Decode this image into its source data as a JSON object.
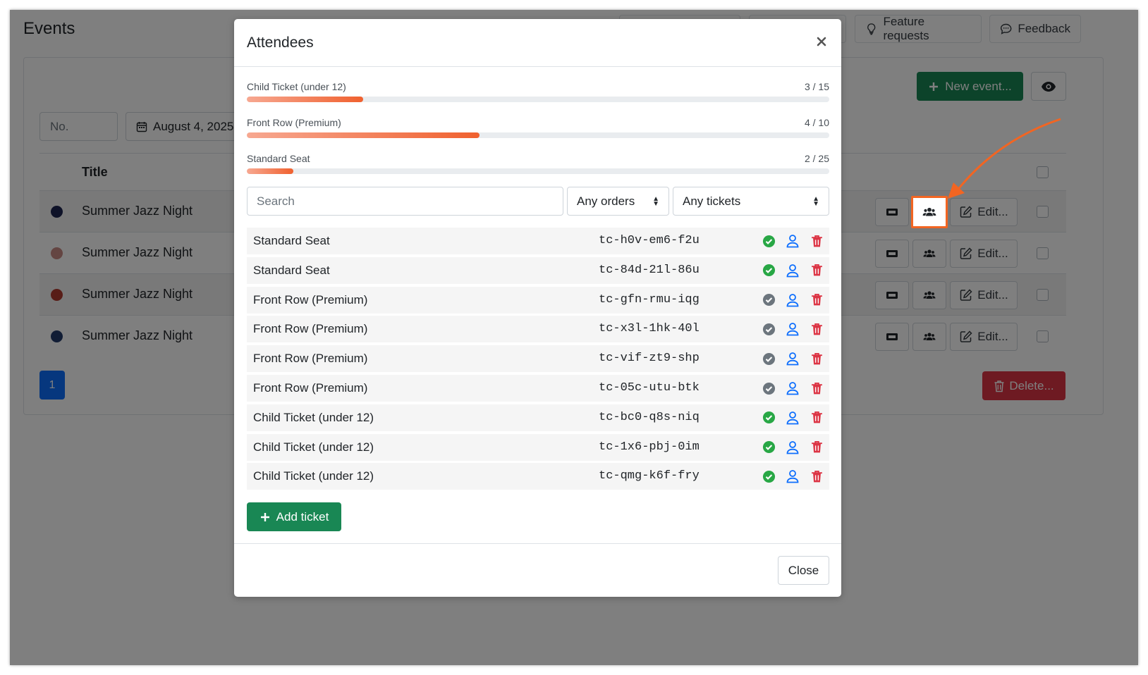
{
  "app": {
    "title": "Events",
    "top_buttons": [
      {
        "label": ""
      },
      {
        "label": ""
      },
      {
        "label": "Feature requests",
        "icon": "lightbulb-icon"
      },
      {
        "label": "Feedback",
        "icon": "chat-icon"
      }
    ],
    "filters": {
      "number_placeholder": "No.",
      "date_value": "August 4, 2025"
    },
    "new_event_label": "New event...",
    "table": {
      "title_header": "Title",
      "rows": [
        {
          "title": "Summer Jazz Night",
          "color": "#1c2450"
        },
        {
          "title": "Summer Jazz Night",
          "color": "#c98a84"
        },
        {
          "title": "Summer Jazz Night",
          "color": "#b03a2e"
        },
        {
          "title": "Summer Jazz Night",
          "color": "#233a6b"
        }
      ],
      "edit_label": "Edit..."
    },
    "pagination": {
      "current": "1"
    },
    "delete_label": "Delete..."
  },
  "modal": {
    "title": "Attendees",
    "capacity": [
      {
        "label": "Child Ticket (under 12)",
        "count": "3 / 15",
        "fraction": 0.2
      },
      {
        "label": "Front Row (Premium)",
        "count": "4 / 10",
        "fraction": 0.4
      },
      {
        "label": "Standard Seat",
        "count": "2 / 25",
        "fraction": 0.08
      }
    ],
    "search_placeholder": "Search",
    "orders_filter": "Any orders",
    "tickets_filter": "Any tickets",
    "tickets": [
      {
        "type": "Standard Seat",
        "code": "tc-h0v-em6-f2u",
        "checked_in": true
      },
      {
        "type": "Standard Seat",
        "code": "tc-84d-21l-86u",
        "checked_in": true
      },
      {
        "type": "Front Row (Premium)",
        "code": "tc-gfn-rmu-iqg",
        "checked_in": false
      },
      {
        "type": "Front Row (Premium)",
        "code": "tc-x3l-1hk-40l",
        "checked_in": false
      },
      {
        "type": "Front Row (Premium)",
        "code": "tc-vif-zt9-shp",
        "checked_in": false
      },
      {
        "type": "Front Row (Premium)",
        "code": "tc-05c-utu-btk",
        "checked_in": false
      },
      {
        "type": "Child Ticket (under 12)",
        "code": "tc-bc0-q8s-niq",
        "checked_in": true
      },
      {
        "type": "Child Ticket (under 12)",
        "code": "tc-1x6-pbj-0im",
        "checked_in": true
      },
      {
        "type": "Child Ticket (under 12)",
        "code": "tc-qmg-k6f-fry",
        "checked_in": true
      }
    ],
    "add_ticket_label": "Add ticket",
    "close_label": "Close"
  },
  "colors": {
    "primary": "#0d6efd",
    "success": "#198754",
    "danger": "#dc3545",
    "checked": "#28a745",
    "unchecked": "#6c757d",
    "highlight": "#f26522"
  }
}
